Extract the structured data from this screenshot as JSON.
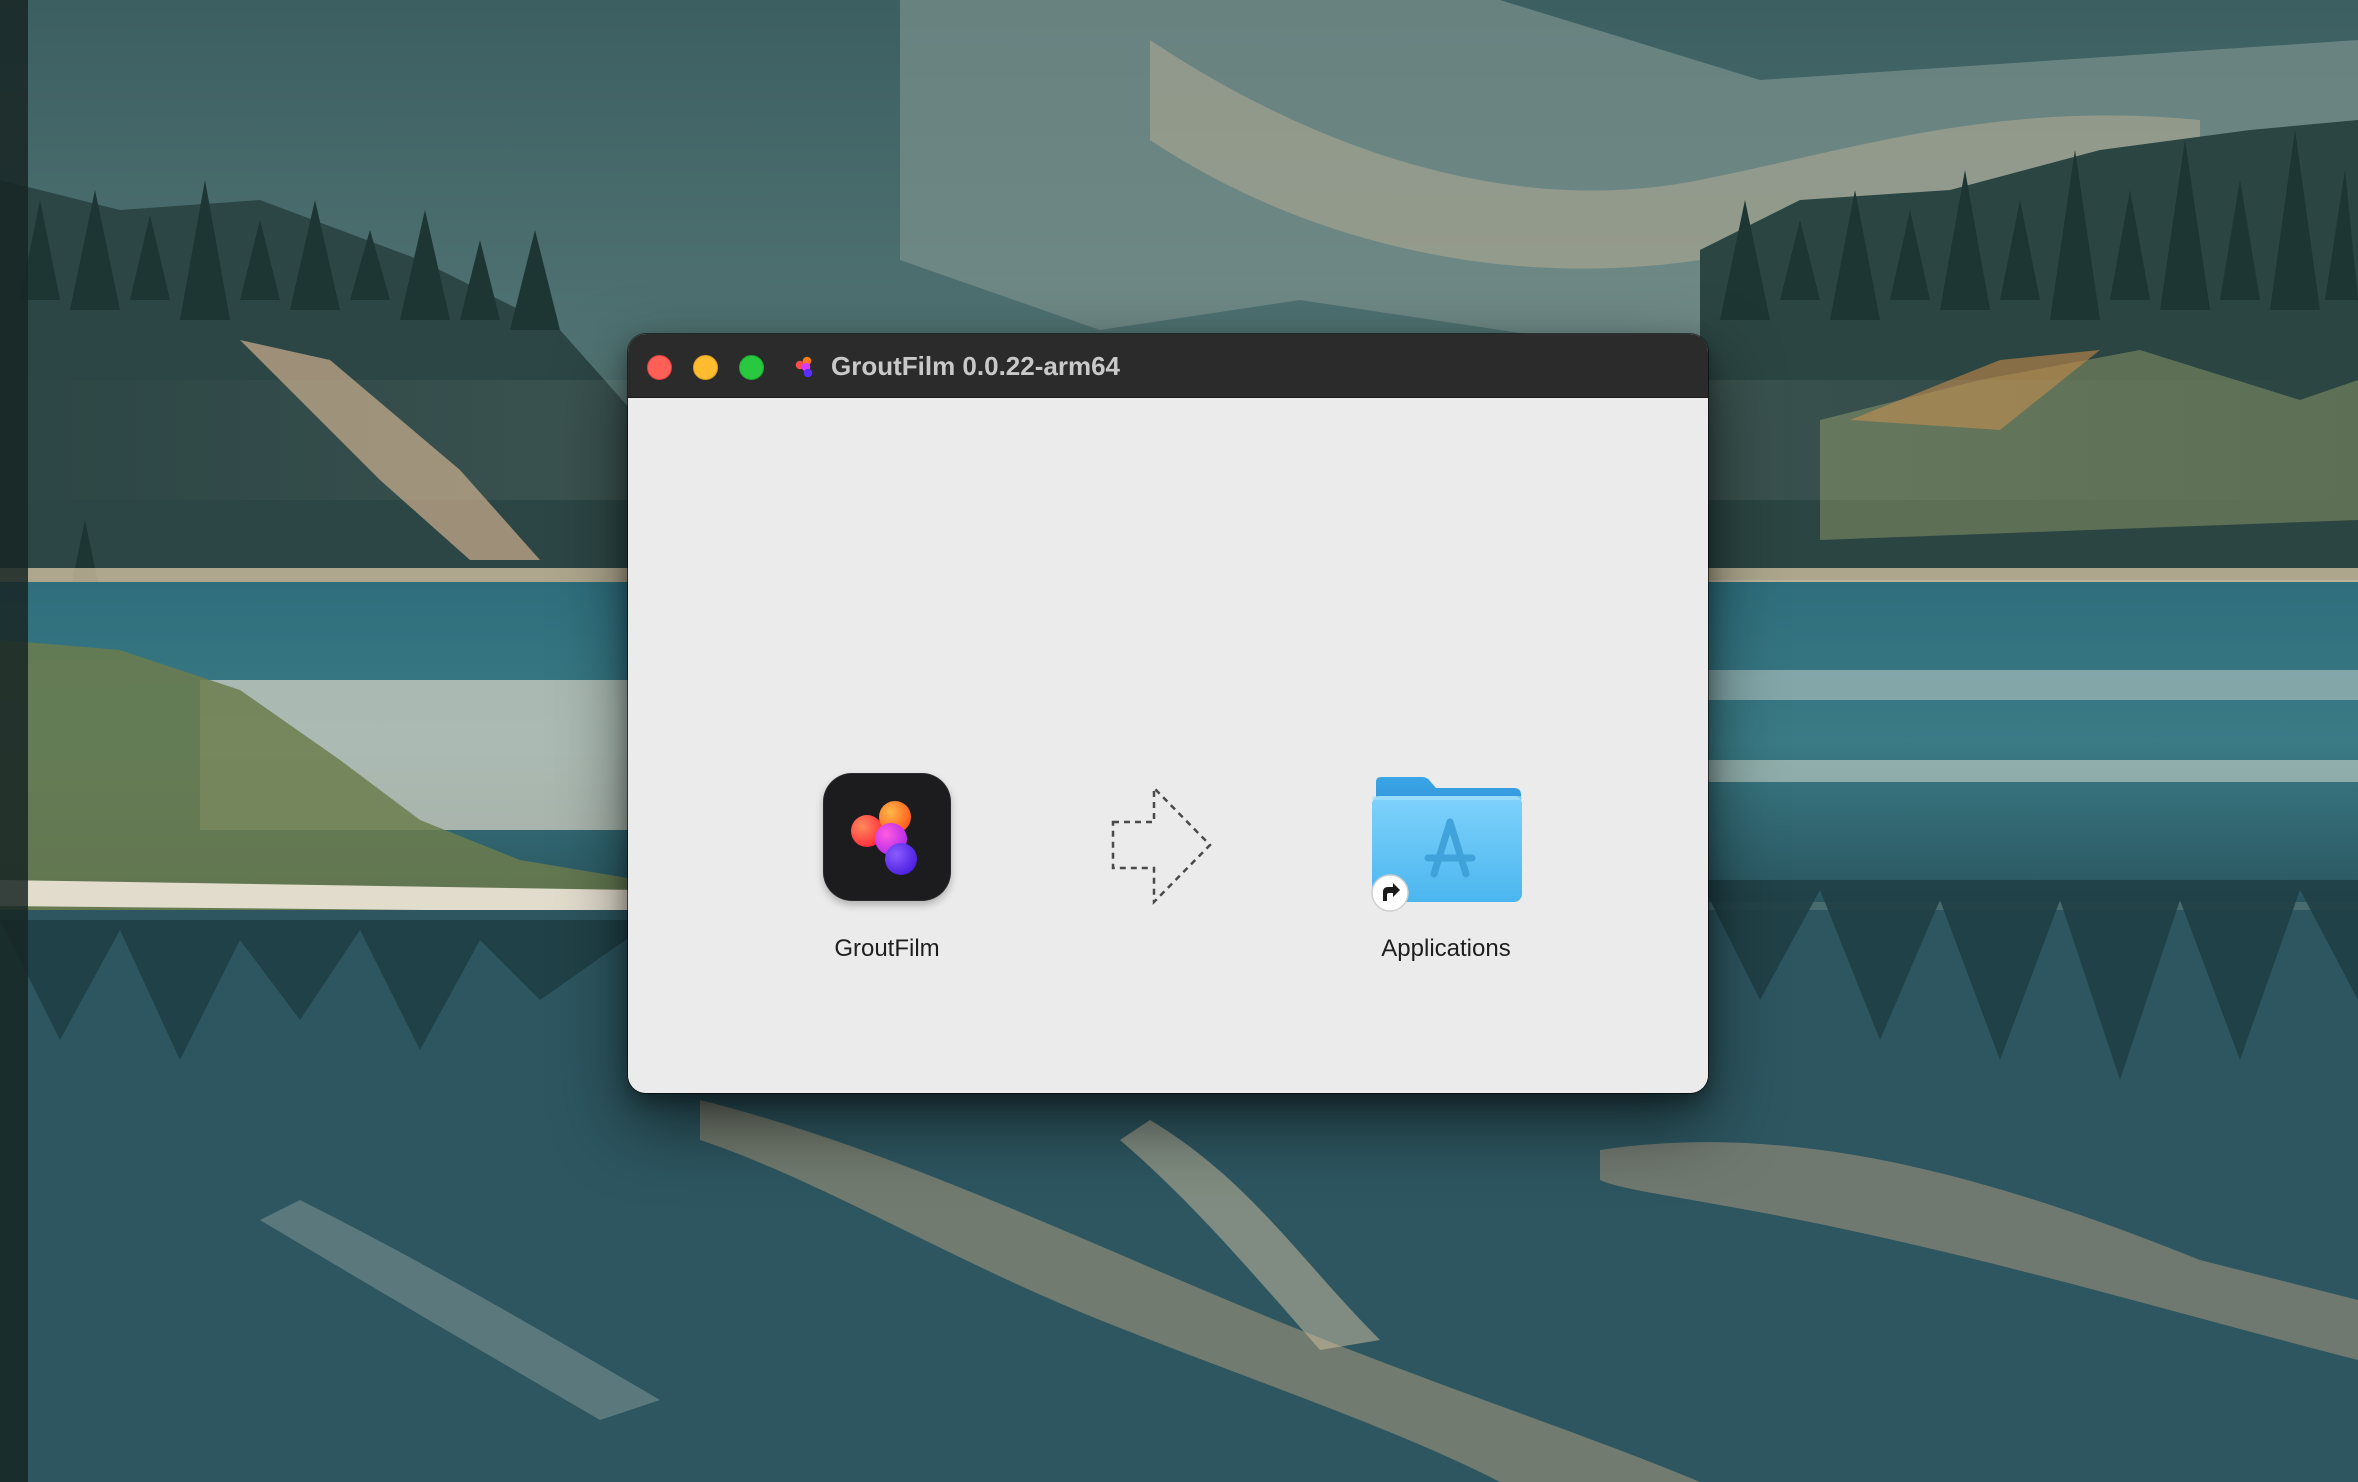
{
  "window": {
    "title": "GroutFilm 0.0.22-arm64"
  },
  "titlebar": {
    "close_icon": "close-icon",
    "minimize_icon": "minimize-icon",
    "zoom_icon": "zoom-icon",
    "app_icon": "groutfilm-app-icon"
  },
  "installer": {
    "app_label": "GroutFilm",
    "app_icon": "groutfilm-app-icon",
    "arrow_icon": "dashed-arrow-right-icon",
    "folder_label": "Applications",
    "folder_icon": "applications-folder-icon",
    "alias_icon": "alias-arrow-icon"
  },
  "colors": {
    "close": "#fe5f57",
    "minimize": "#febc2e",
    "zoom": "#28c840",
    "titlebar": "#2b2b2b",
    "window_bg": "#ebebeb",
    "folder_blue": "#5bc1f2"
  }
}
